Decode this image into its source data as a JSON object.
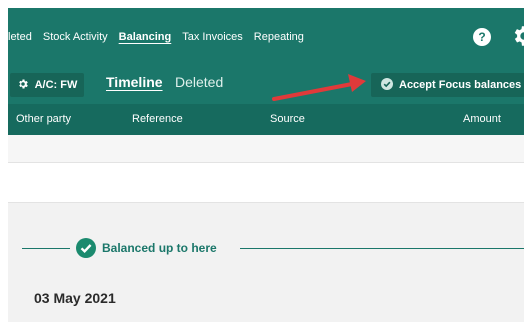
{
  "nav": {
    "tabs": [
      {
        "label": "leted"
      },
      {
        "label": "Stock Activity"
      },
      {
        "label": "Balancing"
      },
      {
        "label": "Tax Invoices"
      },
      {
        "label": "Repeating"
      }
    ],
    "help_label": "?",
    "icons": {
      "help": "help-icon",
      "settings": "gear-icon"
    }
  },
  "toolbar": {
    "account_label": "A/C: FW",
    "timeline_label": "Timeline",
    "deleted_label": "Deleted",
    "accept_label": "Accept Focus balances"
  },
  "table": {
    "columns": [
      "Other party",
      "Reference",
      "Source",
      "Amount"
    ]
  },
  "balance": {
    "label": "Balanced up to here",
    "date": "03 May 2021"
  },
  "colors": {
    "brand": "#1b776a",
    "header_row": "#166a5e",
    "button": "#176558",
    "annotation_arrow": "#e03a3a"
  }
}
